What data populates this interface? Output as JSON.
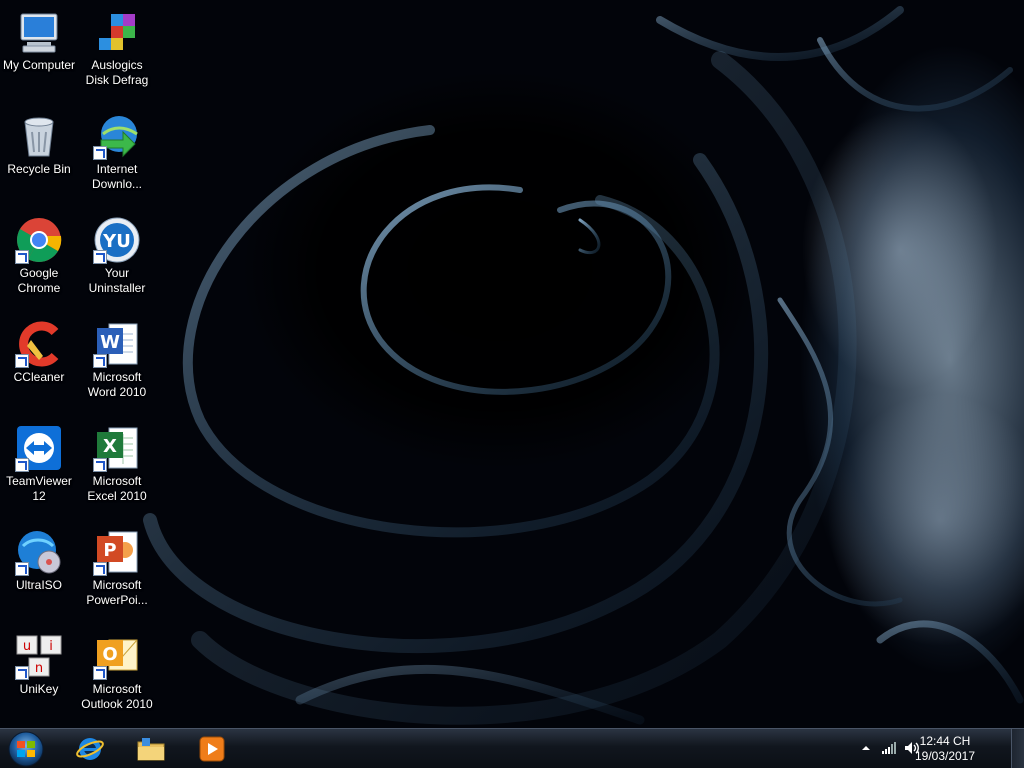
{
  "desktop": {
    "icons": [
      {
        "label": "My Computer",
        "icon": "computer-icon"
      },
      {
        "label": "Auslogics\nDisk Defrag",
        "icon": "disk-defrag-icon"
      },
      {
        "label": "Recycle Bin",
        "icon": "recycle-bin-icon"
      },
      {
        "label": "Internet\nDownlo...",
        "icon": "internet-download-manager-icon"
      },
      {
        "label": "Google\nChrome",
        "icon": "chrome-icon"
      },
      {
        "label": "Your\nUninstaller",
        "icon": "your-uninstaller-icon"
      },
      {
        "label": "CCleaner",
        "icon": "ccleaner-icon"
      },
      {
        "label": "Microsoft\nWord 2010",
        "icon": "word-icon"
      },
      {
        "label": "TeamViewer\n12",
        "icon": "teamviewer-icon"
      },
      {
        "label": "Microsoft\nExcel 2010",
        "icon": "excel-icon"
      },
      {
        "label": "UltraISO",
        "icon": "ultraiso-icon"
      },
      {
        "label": "Microsoft\nPowerPoi...",
        "icon": "powerpoint-icon"
      },
      {
        "label": "UniKey",
        "icon": "unikey-icon"
      },
      {
        "label": "Microsoft\nOutlook 2010",
        "icon": "outlook-icon"
      }
    ]
  },
  "taskbar": {
    "pinned": [
      {
        "icon": "internet-explorer-icon"
      },
      {
        "icon": "file-explorer-icon"
      },
      {
        "icon": "media-player-icon"
      }
    ],
    "clock": {
      "time": "12:44 CH",
      "date": "19/03/2017"
    }
  },
  "colors": {
    "taskbar": "#11161e",
    "accent": "#1f57c9"
  }
}
